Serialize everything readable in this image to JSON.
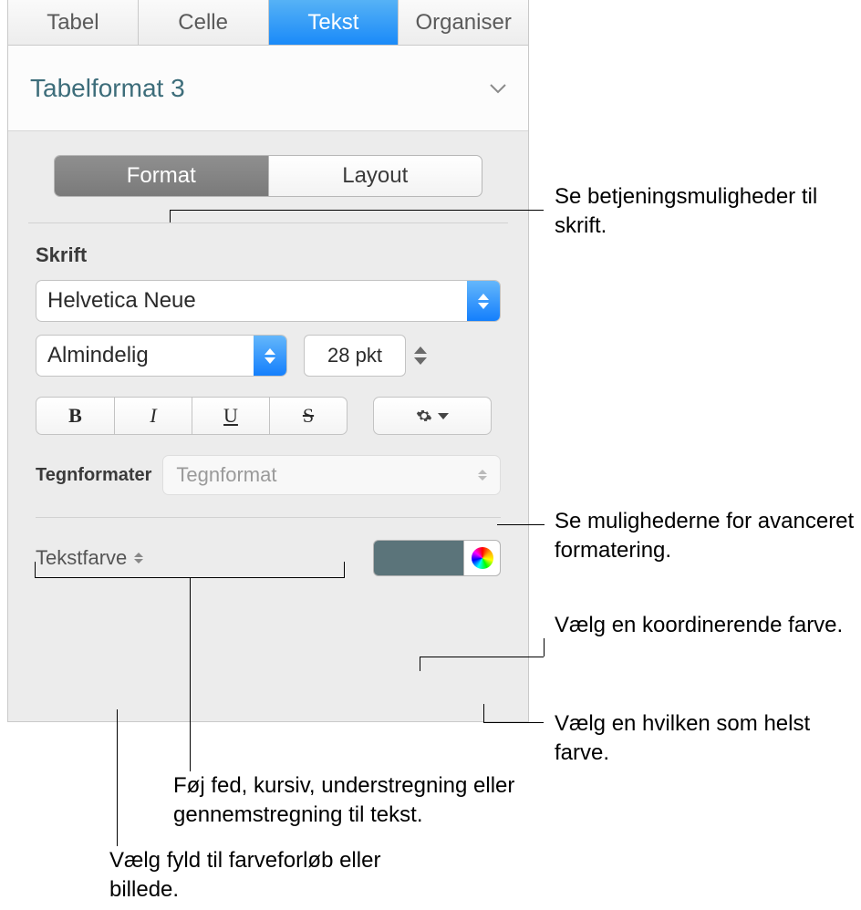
{
  "tabs": {
    "tabel": "Tabel",
    "celle": "Celle",
    "tekst": "Tekst",
    "organiser": "Organiser"
  },
  "styleName": "Tabelformat 3",
  "seg": {
    "format": "Format",
    "layout": "Layout"
  },
  "font": {
    "section": "Skrift",
    "family": "Helvetica Neue",
    "style": "Almindelig",
    "size": "28 pkt"
  },
  "charStyles": {
    "label": "Tegnformater",
    "placeholder": "Tegnformat"
  },
  "textColor": {
    "label": "Tekstfarve"
  },
  "callouts": {
    "formatSeg": "Se betjeningsmuligheder til skrift.",
    "advanced": "Se mulighederne for avanceret formatering.",
    "coordColor": "Vælg en koordinerende farve.",
    "anyColor": "Vælg en hvilken som helst farve.",
    "bius": "Føj fed, kursiv, understregning eller gennemstregning til tekst.",
    "fill": "Vælg fyld til farveforløb eller billede."
  }
}
